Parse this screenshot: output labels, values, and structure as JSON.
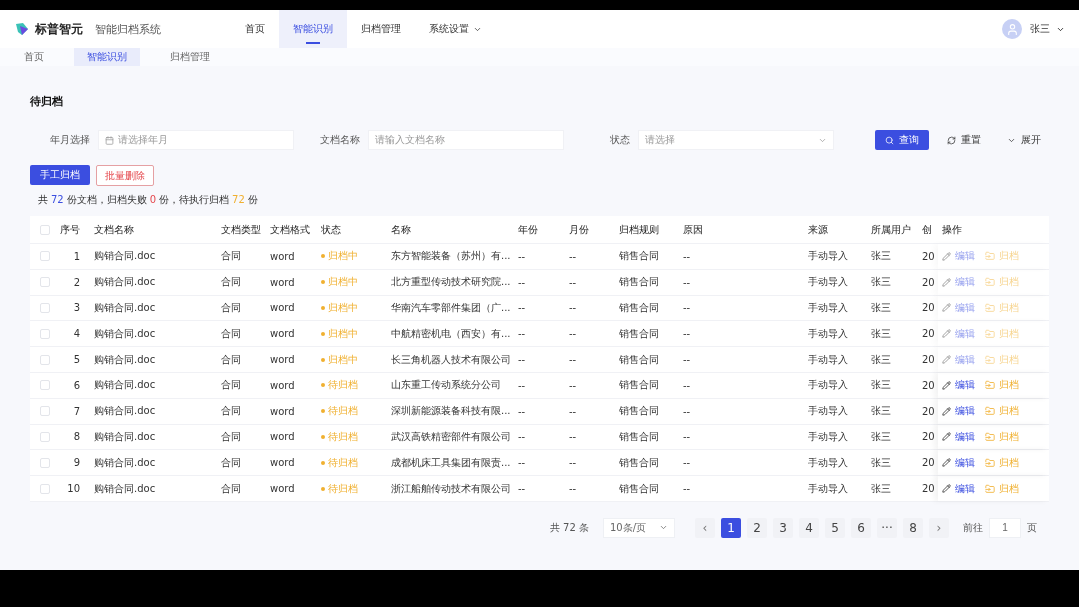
{
  "header": {
    "brand": "标普智元",
    "system": "智能归档系统",
    "nav": [
      {
        "label": "首页",
        "selected": false,
        "dropdown": false
      },
      {
        "label": "智能识别",
        "selected": true,
        "dropdown": false
      },
      {
        "label": "归档管理",
        "selected": false,
        "dropdown": false
      },
      {
        "label": "系统设置",
        "selected": false,
        "dropdown": true
      }
    ],
    "user": "张三"
  },
  "tabs": [
    {
      "label": "首页",
      "selected": false
    },
    {
      "label": "智能识别",
      "selected": true
    },
    {
      "label": "归档管理",
      "selected": false
    }
  ],
  "title": "待归档",
  "filters": [
    {
      "kind": "date",
      "label": "年月选择",
      "placeholder": "请选择年月"
    },
    {
      "kind": "text",
      "label": "文档名称",
      "placeholder": "请输入文档名称"
    },
    {
      "kind": "select",
      "label": "状态",
      "placeholder": "请选择"
    }
  ],
  "filter_buttons": {
    "search": "查询",
    "reset": "重置",
    "expand": "展开"
  },
  "actions": {
    "manual": "手工归档",
    "batch_delete": "批量删除"
  },
  "summary": {
    "p1": "共",
    "total": "72",
    "p2": "份文档，归档失败",
    "failed": "0",
    "p3": "份，待执行归档",
    "pending": "72",
    "p4": "份"
  },
  "table": {
    "all_checked": false,
    "columns": [
      "序号",
      "文档名称",
      "文档类型",
      "文档格式",
      "状态",
      "名称",
      "年份",
      "月份",
      "归档规则",
      "原因",
      "来源",
      "所属用户",
      "创",
      "操作"
    ],
    "rows": [
      {
        "checked": false,
        "cells": [
          "1",
          "购销合同.doc",
          "合同",
          "word",
          "归档中",
          "东方智能装备（苏州）有...",
          "--",
          "--",
          "销售合同",
          "--",
          "手动导入",
          "张三",
          "20"
        ],
        "actions_disabled": true,
        "edit": "编辑",
        "archive": "归档"
      },
      {
        "checked": false,
        "cells": [
          "2",
          "购销合同.doc",
          "合同",
          "word",
          "归档中",
          "北方重型传动技术研究院...",
          "--",
          "--",
          "销售合同",
          "--",
          "手动导入",
          "张三",
          "20"
        ],
        "actions_disabled": true,
        "edit": "编辑",
        "archive": "归档"
      },
      {
        "checked": false,
        "cells": [
          "3",
          "购销合同.doc",
          "合同",
          "word",
          "归档中",
          "华南汽车零部件集团（广...",
          "--",
          "--",
          "销售合同",
          "--",
          "手动导入",
          "张三",
          "20"
        ],
        "actions_disabled": true,
        "edit": "编辑",
        "archive": "归档"
      },
      {
        "checked": false,
        "cells": [
          "4",
          "购销合同.doc",
          "合同",
          "word",
          "归档中",
          "中航精密机电（西安）有...",
          "--",
          "--",
          "销售合同",
          "--",
          "手动导入",
          "张三",
          "20"
        ],
        "actions_disabled": true,
        "edit": "编辑",
        "archive": "归档"
      },
      {
        "checked": false,
        "cells": [
          "5",
          "购销合同.doc",
          "合同",
          "word",
          "归档中",
          "长三角机器人技术有限公司",
          "--",
          "--",
          "销售合同",
          "--",
          "手动导入",
          "张三",
          "20"
        ],
        "actions_disabled": true,
        "edit": "编辑",
        "archive": "归档"
      },
      {
        "checked": false,
        "cells": [
          "6",
          "购销合同.doc",
          "合同",
          "word",
          "待归档",
          "山东重工传动系统分公司",
          "--",
          "--",
          "销售合同",
          "--",
          "手动导入",
          "张三",
          "20"
        ],
        "actions_disabled": false,
        "edit": "编辑",
        "archive": "归档"
      },
      {
        "checked": false,
        "cells": [
          "7",
          "购销合同.doc",
          "合同",
          "word",
          "待归档",
          "深圳新能源装备科技有限...",
          "--",
          "--",
          "销售合同",
          "--",
          "手动导入",
          "张三",
          "20"
        ],
        "actions_disabled": false,
        "edit": "编辑",
        "archive": "归档"
      },
      {
        "checked": false,
        "cells": [
          "8",
          "购销合同.doc",
          "合同",
          "word",
          "待归档",
          "武汉高铁精密部件有限公司",
          "--",
          "--",
          "销售合同",
          "--",
          "手动导入",
          "张三",
          "20"
        ],
        "actions_disabled": false,
        "edit": "编辑",
        "archive": "归档"
      },
      {
        "checked": false,
        "cells": [
          "9",
          "购销合同.doc",
          "合同",
          "word",
          "待归档",
          "成都机床工具集团有限责...",
          "--",
          "--",
          "销售合同",
          "--",
          "手动导入",
          "张三",
          "20"
        ],
        "actions_disabled": false,
        "edit": "编辑",
        "archive": "归档"
      },
      {
        "checked": false,
        "cells": [
          "10",
          "购销合同.doc",
          "合同",
          "word",
          "待归档",
          "浙江船舶传动技术有限公司",
          "--",
          "--",
          "销售合同",
          "--",
          "手动导入",
          "张三",
          "20"
        ],
        "actions_disabled": false,
        "edit": "编辑",
        "archive": "归档"
      }
    ]
  },
  "pagination": {
    "total": "共 72 条",
    "page_size": "10条/页",
    "prev": "‹",
    "pages": [
      {
        "label": "1",
        "selected": true
      },
      {
        "label": "2",
        "selected": false
      },
      {
        "label": "3",
        "selected": false
      },
      {
        "label": "4",
        "selected": false
      },
      {
        "label": "5",
        "selected": false
      },
      {
        "label": "6",
        "selected": false
      },
      {
        "label": "···",
        "selected": false
      },
      {
        "label": "8",
        "selected": false
      }
    ],
    "next": "›",
    "goto": "前往",
    "goto_value": "1",
    "goto_suffix": "页"
  }
}
